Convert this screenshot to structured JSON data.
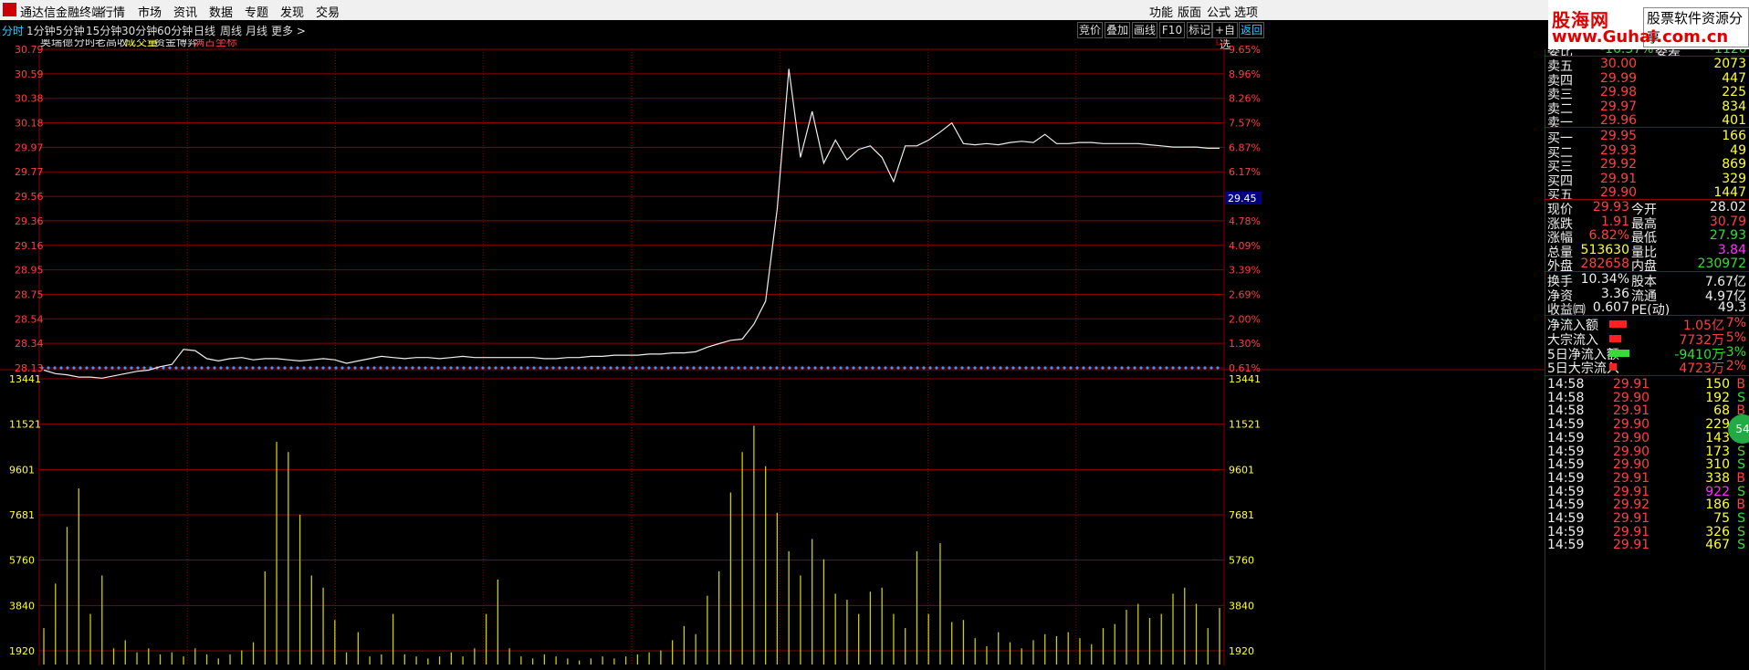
{
  "menubar": {
    "title": "通达信金融终端",
    "items": [
      "行情",
      "市场",
      "资讯",
      "数据",
      "专题",
      "发现",
      "交易"
    ],
    "right_items": [
      "功能",
      "版面",
      "公式",
      "选项"
    ]
  },
  "logo": {
    "line1": "股海网",
    "line2": "股票软件资源分享",
    "line3": "www.Guhai.com.cn"
  },
  "tabs": [
    "分时",
    "1分钟",
    "5分钟",
    "15分钟",
    "30分钟",
    "60分钟",
    "日线",
    "周线",
    "月线",
    "更多 >"
  ],
  "right_tools": [
    "竞价",
    "叠加",
    "画线",
    "F10",
    "标记",
    "+自选",
    "返回"
  ],
  "chart_header": {
    "stock": "奥瑞德",
    "mode": "分时",
    "option": "老高收",
    "volume_label": "成交量",
    "capital_label": "资金博弈",
    "coord_label": "满占坐标"
  },
  "price_ticks": [
    "30.79",
    "30.59",
    "30.38",
    "30.18",
    "29.97",
    "29.77",
    "29.56",
    "29.36",
    "29.16",
    "28.95",
    "28.75",
    "28.54",
    "28.34",
    "28.13"
  ],
  "pct_ticks": [
    "9.65%",
    "8.96%",
    "8.26%",
    "7.57%",
    "6.87%",
    "6.17%",
    "5.48%",
    "4.78%",
    "4.09%",
    "3.39%",
    "2.69%",
    "2.00%",
    "1.30%",
    "0.61%"
  ],
  "vol_ticks": [
    "13441",
    "11521",
    "9601",
    "7681",
    "5760",
    "3840",
    "1920"
  ],
  "price_marker": "29.45",
  "chart_data": {
    "type": "line",
    "ylim": [
      28.02,
      30.79
    ],
    "price": [
      28.0,
      27.97,
      27.96,
      27.94,
      27.94,
      27.93,
      27.95,
      27.97,
      27.99,
      28.0,
      28.03,
      28.05,
      28.18,
      28.17,
      28.1,
      28.08,
      28.1,
      28.11,
      28.09,
      28.1,
      28.1,
      28.09,
      28.08,
      28.09,
      28.1,
      28.09,
      28.06,
      28.08,
      28.1,
      28.12,
      28.11,
      28.1,
      28.11,
      28.11,
      28.1,
      28.11,
      28.12,
      28.11,
      28.11,
      28.11,
      28.11,
      28.11,
      28.11,
      28.1,
      28.1,
      28.11,
      28.11,
      28.12,
      28.12,
      28.13,
      28.13,
      28.13,
      28.14,
      28.14,
      28.15,
      28.15,
      28.16,
      28.2,
      28.23,
      28.26,
      28.27,
      28.4,
      28.6,
      29.4,
      30.62,
      29.85,
      30.25,
      29.8,
      30.0,
      29.83,
      29.92,
      29.95,
      29.85,
      29.64,
      29.95,
      29.95,
      30.0,
      30.07,
      30.15,
      29.97,
      29.96,
      29.97,
      29.96,
      29.98,
      29.99,
      29.98,
      30.05,
      29.97,
      29.97,
      29.98,
      29.98,
      29.97,
      29.97,
      29.97,
      29.97,
      29.96,
      29.95,
      29.94,
      29.94,
      29.94,
      29.93,
      29.93
    ],
    "volume": [
      1800,
      4000,
      6800,
      8700,
      2500,
      4400,
      800,
      1200,
      600,
      800,
      500,
      600,
      400,
      800,
      500,
      300,
      500,
      700,
      1100,
      4600,
      11000,
      10500,
      7400,
      4400,
      3800,
      2200,
      600,
      1600,
      400,
      500,
      2500,
      500,
      400,
      300,
      400,
      600,
      400,
      800,
      2500,
      4200,
      800,
      400,
      300,
      500,
      400,
      300,
      200,
      300,
      400,
      300,
      400,
      500,
      600,
      700,
      1200,
      1900,
      1500,
      3400,
      4600,
      8500,
      10500,
      11800,
      9800,
      7500,
      5600,
      4400,
      6200,
      5200,
      3500,
      3200,
      2500,
      3600,
      3800,
      2500,
      1800,
      5600,
      2500,
      6000,
      2100,
      2200,
      1300,
      900,
      1600,
      1100,
      800,
      1200,
      1500,
      1400,
      1600,
      1300,
      1000,
      1800,
      2000,
      2700,
      3000,
      2300,
      2500,
      3500,
      3800,
      3000,
      1800,
      2800
    ],
    "avg_line": 28.02
  },
  "orderbook": {
    "header": {
      "l1": "委比",
      "v1": "-16.37%",
      "l2": "委差",
      "v2": "-1120"
    },
    "sells": [
      {
        "label": "卖五",
        "price": "30.00",
        "vol": "2073"
      },
      {
        "label": "卖四",
        "price": "29.99",
        "vol": "447"
      },
      {
        "label": "卖三",
        "price": "29.98",
        "vol": "225"
      },
      {
        "label": "卖二",
        "price": "29.97",
        "vol": "834"
      },
      {
        "label": "卖一",
        "price": "29.96",
        "vol": "401"
      }
    ],
    "buys": [
      {
        "label": "买一",
        "price": "29.95",
        "vol": "166"
      },
      {
        "label": "买二",
        "price": "29.93",
        "vol": "49"
      },
      {
        "label": "买三",
        "price": "29.92",
        "vol": "869"
      },
      {
        "label": "买四",
        "price": "29.91",
        "vol": "329"
      },
      {
        "label": "买五",
        "price": "29.90",
        "vol": "1447"
      }
    ]
  },
  "quote": [
    {
      "l1": "现价",
      "v1": "29.93",
      "c1": "red",
      "l2": "今开",
      "v2": "28.02",
      "c2": "white"
    },
    {
      "l1": "涨跌",
      "v1": "1.91",
      "c1": "red",
      "l2": "最高",
      "v2": "30.79",
      "c2": "red"
    },
    {
      "l1": "涨幅",
      "v1": "6.82%",
      "c1": "red",
      "l2": "最低",
      "v2": "27.93",
      "c2": "green"
    },
    {
      "l1": "总量",
      "v1": "513630",
      "c1": "yellow",
      "l2": "量比",
      "v2": "3.84",
      "c2": "mag"
    },
    {
      "l1": "外盘",
      "v1": "282658",
      "c1": "red",
      "l2": "内盘",
      "v2": "230972",
      "c2": "green"
    }
  ],
  "fundamentals": [
    {
      "l1": "换手",
      "v1": "10.34%",
      "l2": "股本",
      "v2": "7.67亿"
    },
    {
      "l1": "净资",
      "v1": "3.36",
      "l2": "流通",
      "v2": "4.97亿"
    },
    {
      "l1": "收益㈣",
      "v1": "0.607",
      "l2": "PE(动)",
      "v2": "49.3"
    }
  ],
  "flows": [
    {
      "label": "净流入额",
      "value": "1.05亿",
      "pct": "7%",
      "color": "red",
      "bar": 0.8
    },
    {
      "label": "大宗流入",
      "value": "7732万",
      "pct": "5%",
      "color": "red",
      "bar": 0.55
    },
    {
      "label": "5日净流入额",
      "value": "-9410万",
      "pct": "-3%",
      "color": "green",
      "bar": 0.9
    },
    {
      "label": "5日大宗流入",
      "value": "4723万",
      "pct": "2%",
      "color": "red",
      "bar": 0.35
    }
  ],
  "ticks": [
    {
      "time": "14:58",
      "price": "29.91",
      "vol": "150",
      "bs": "B"
    },
    {
      "time": "14:58",
      "price": "29.90",
      "vol": "192",
      "bs": "S"
    },
    {
      "time": "14:58",
      "price": "29.91",
      "vol": "68",
      "bs": "B"
    },
    {
      "time": "14:59",
      "price": "29.90",
      "vol": "229",
      "bs": "S"
    },
    {
      "time": "14:59",
      "price": "29.90",
      "vol": "143",
      "bs": "S"
    },
    {
      "time": "14:59",
      "price": "29.90",
      "vol": "173",
      "bs": "S"
    },
    {
      "time": "14:59",
      "price": "29.90",
      "vol": "310",
      "bs": "S"
    },
    {
      "time": "14:59",
      "price": "29.91",
      "vol": "338",
      "bs": "B"
    },
    {
      "time": "14:59",
      "price": "29.91",
      "vol": "922",
      "bs": "S"
    },
    {
      "time": "14:59",
      "price": "29.92",
      "vol": "186",
      "bs": "B"
    },
    {
      "time": "14:59",
      "price": "29.91",
      "vol": "75",
      "bs": "S"
    },
    {
      "time": "14:59",
      "price": "29.91",
      "vol": "326",
      "bs": "S"
    },
    {
      "time": "14:59",
      "price": "29.91",
      "vol": "467",
      "bs": "S"
    }
  ],
  "float_badge": "54"
}
